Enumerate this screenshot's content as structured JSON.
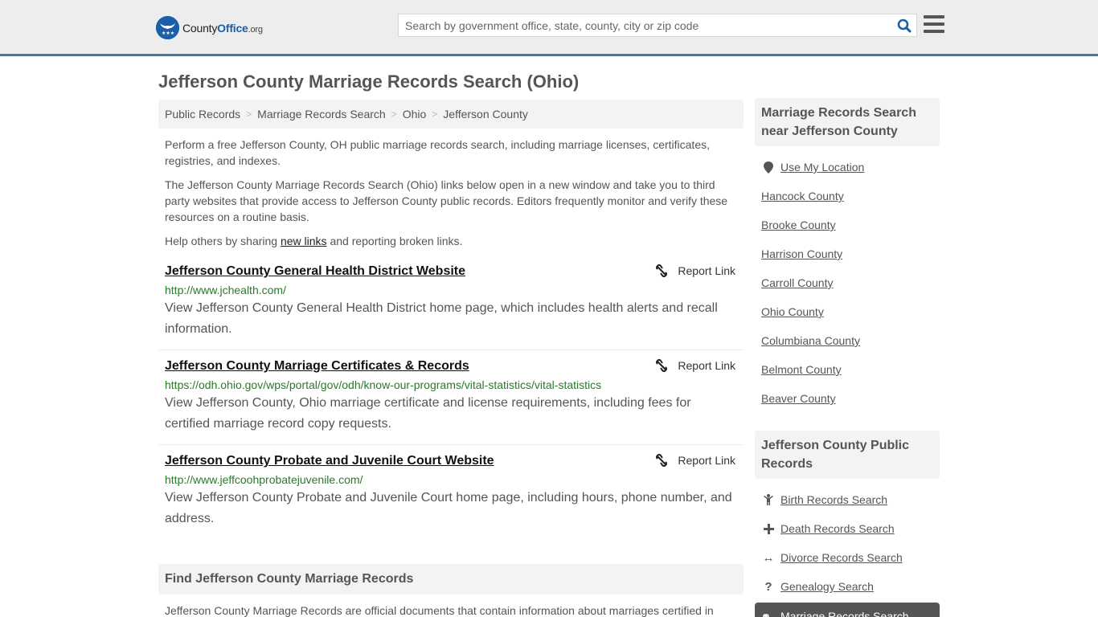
{
  "header": {
    "logo": {
      "name_part1": "County",
      "name_part2": "Office",
      "name_suffix": ".org"
    },
    "search": {
      "placeholder": "Search by government office, state, county, city or zip code",
      "value": ""
    }
  },
  "page": {
    "title": "Jefferson County Marriage Records Search (Ohio)"
  },
  "breadcrumb": [
    {
      "label": "Public Records"
    },
    {
      "label": "Marriage Records Search"
    },
    {
      "label": "Ohio"
    },
    {
      "label": "Jefferson County"
    }
  ],
  "intro": {
    "p1": "Perform a free Jefferson County, OH public marriage records search, including marriage licenses, certificates, registries, and indexes.",
    "p2": "The Jefferson County Marriage Records Search (Ohio) links below open in a new window and take you to third party websites that provide access to Jefferson County public records. Editors frequently monitor and verify these resources on a routine basis.",
    "p3_before": "Help others by sharing ",
    "p3_link": "new links",
    "p3_after": " and reporting broken links."
  },
  "links": [
    {
      "title": "Jefferson County General Health District Website",
      "url": "http://www.jchealth.com/",
      "description": "View Jefferson County General Health District home page, which includes health alerts and recall information.",
      "report_label": "Report Link"
    },
    {
      "title": "Jefferson County Marriage Certificates & Records",
      "url": "https://odh.ohio.gov/wps/portal/gov/odh/know-our-programs/vital-statistics/vital-statistics",
      "description": "View Jefferson County, Ohio marriage certificate and license requirements, including fees for certified marriage record copy requests.",
      "report_label": "Report Link"
    },
    {
      "title": "Jefferson County Probate and Juvenile Court Website",
      "url": "http://www.jeffcoohprobatejuvenile.com/",
      "description": "View Jefferson County Probate and Juvenile Court home page, including hours, phone number, and address.",
      "report_label": "Report Link"
    }
  ],
  "find_section": {
    "heading": "Find Jefferson County Marriage Records",
    "text": "Jefferson County Marriage Records are official documents that contain information about marriages certified in"
  },
  "sidebar": {
    "nearby": {
      "heading": "Marriage Records Search near Jefferson County",
      "use_location": "Use My Location",
      "counties": [
        "Hancock County",
        "Brooke County",
        "Harrison County",
        "Carroll County",
        "Ohio County",
        "Columbiana County",
        "Belmont County",
        "Beaver County"
      ]
    },
    "public_records": {
      "heading": "Jefferson County Public Records",
      "items": [
        {
          "label": "Birth Records Search",
          "icon": "child-icon"
        },
        {
          "label": "Death Records Search",
          "icon": "cross-icon"
        },
        {
          "label": "Divorce Records Search",
          "icon": "arrows-horizontal-icon"
        },
        {
          "label": "Genealogy Search",
          "icon": "question-icon"
        }
      ],
      "active_item": {
        "label": "Marriage Records Search",
        "icon": "marriage-rings-icon"
      }
    }
  },
  "colors": {
    "brand_blue": "#1a5fa8",
    "header_border": "#3d79a8",
    "url_green": "#2a7a2a",
    "active_bg": "#555555"
  }
}
